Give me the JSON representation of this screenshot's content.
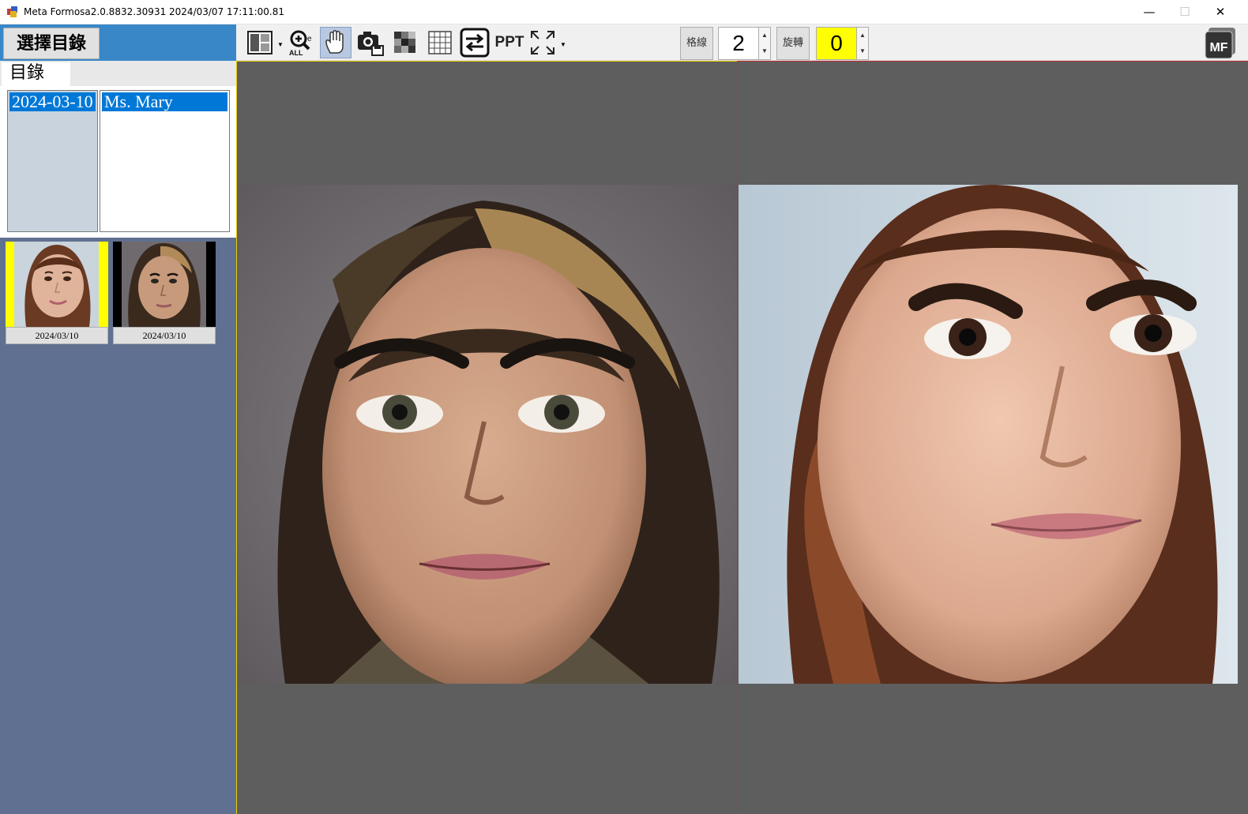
{
  "window": {
    "title": "Meta Formosa2.0.8832.30931 2024/03/07 17:11:00.81",
    "minimize_glyph": "—",
    "maximize_glyph": "☐",
    "close_glyph": "✕"
  },
  "left_panel": {
    "choose_dir_label": "選擇目錄",
    "tab_label": "目錄",
    "date_list": {
      "selected": "2024-03-10"
    },
    "name_list": {
      "selected": "Ms. Mary"
    },
    "thumbnails": [
      {
        "caption": "2024/03/10",
        "icon": "portrait-thumbnail-woman-smiling",
        "highlight_color": "#ffff00"
      },
      {
        "caption": "2024/03/10",
        "icon": "portrait-thumbnail-woman-neutral",
        "highlight_color": "#000000"
      }
    ]
  },
  "toolbar": {
    "layout_icon": "layout-icon",
    "zoom_all_icon": "zoom-all-icon",
    "pan_icon": "hand-pan-icon",
    "snapshot_icon": "camera-save-icon",
    "mosaic_icon": "mosaic-icon",
    "grid_icon": "grid-icon",
    "swap_icon": "swap-icon",
    "ppt_label": "PPT",
    "fullscreen_icon": "fullscreen-icon",
    "grid_lines_label": "格線",
    "grid_lines_value": "2",
    "rotate_label": "旋轉",
    "rotate_value": "0",
    "rotate_highlight": "#ffff00",
    "logo_label": "MF"
  },
  "viewer": {
    "left_pane_border": "#e8d000",
    "right_pane_border": "#c03030",
    "left_image": "portrait-woman-neutral",
    "right_image": "portrait-woman-smiling"
  }
}
